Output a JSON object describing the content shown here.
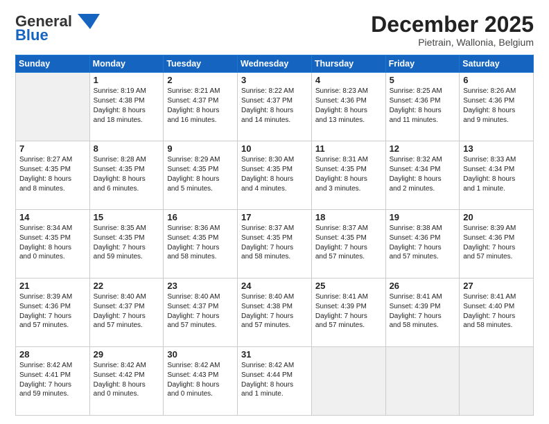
{
  "logo": {
    "general": "General",
    "blue": "Blue"
  },
  "header": {
    "month": "December 2025",
    "location": "Pietrain, Wallonia, Belgium"
  },
  "weekdays": [
    "Sunday",
    "Monday",
    "Tuesday",
    "Wednesday",
    "Thursday",
    "Friday",
    "Saturday"
  ],
  "weeks": [
    [
      {
        "day": "",
        "detail": ""
      },
      {
        "day": "1",
        "detail": "Sunrise: 8:19 AM\nSunset: 4:38 PM\nDaylight: 8 hours\nand 18 minutes."
      },
      {
        "day": "2",
        "detail": "Sunrise: 8:21 AM\nSunset: 4:37 PM\nDaylight: 8 hours\nand 16 minutes."
      },
      {
        "day": "3",
        "detail": "Sunrise: 8:22 AM\nSunset: 4:37 PM\nDaylight: 8 hours\nand 14 minutes."
      },
      {
        "day": "4",
        "detail": "Sunrise: 8:23 AM\nSunset: 4:36 PM\nDaylight: 8 hours\nand 13 minutes."
      },
      {
        "day": "5",
        "detail": "Sunrise: 8:25 AM\nSunset: 4:36 PM\nDaylight: 8 hours\nand 11 minutes."
      },
      {
        "day": "6",
        "detail": "Sunrise: 8:26 AM\nSunset: 4:36 PM\nDaylight: 8 hours\nand 9 minutes."
      }
    ],
    [
      {
        "day": "7",
        "detail": "Sunrise: 8:27 AM\nSunset: 4:35 PM\nDaylight: 8 hours\nand 8 minutes."
      },
      {
        "day": "8",
        "detail": "Sunrise: 8:28 AM\nSunset: 4:35 PM\nDaylight: 8 hours\nand 6 minutes."
      },
      {
        "day": "9",
        "detail": "Sunrise: 8:29 AM\nSunset: 4:35 PM\nDaylight: 8 hours\nand 5 minutes."
      },
      {
        "day": "10",
        "detail": "Sunrise: 8:30 AM\nSunset: 4:35 PM\nDaylight: 8 hours\nand 4 minutes."
      },
      {
        "day": "11",
        "detail": "Sunrise: 8:31 AM\nSunset: 4:35 PM\nDaylight: 8 hours\nand 3 minutes."
      },
      {
        "day": "12",
        "detail": "Sunrise: 8:32 AM\nSunset: 4:34 PM\nDaylight: 8 hours\nand 2 minutes."
      },
      {
        "day": "13",
        "detail": "Sunrise: 8:33 AM\nSunset: 4:34 PM\nDaylight: 8 hours\nand 1 minute."
      }
    ],
    [
      {
        "day": "14",
        "detail": "Sunrise: 8:34 AM\nSunset: 4:35 PM\nDaylight: 8 hours\nand 0 minutes."
      },
      {
        "day": "15",
        "detail": "Sunrise: 8:35 AM\nSunset: 4:35 PM\nDaylight: 7 hours\nand 59 minutes."
      },
      {
        "day": "16",
        "detail": "Sunrise: 8:36 AM\nSunset: 4:35 PM\nDaylight: 7 hours\nand 58 minutes."
      },
      {
        "day": "17",
        "detail": "Sunrise: 8:37 AM\nSunset: 4:35 PM\nDaylight: 7 hours\nand 58 minutes."
      },
      {
        "day": "18",
        "detail": "Sunrise: 8:37 AM\nSunset: 4:35 PM\nDaylight: 7 hours\nand 57 minutes."
      },
      {
        "day": "19",
        "detail": "Sunrise: 8:38 AM\nSunset: 4:36 PM\nDaylight: 7 hours\nand 57 minutes."
      },
      {
        "day": "20",
        "detail": "Sunrise: 8:39 AM\nSunset: 4:36 PM\nDaylight: 7 hours\nand 57 minutes."
      }
    ],
    [
      {
        "day": "21",
        "detail": "Sunrise: 8:39 AM\nSunset: 4:36 PM\nDaylight: 7 hours\nand 57 minutes."
      },
      {
        "day": "22",
        "detail": "Sunrise: 8:40 AM\nSunset: 4:37 PM\nDaylight: 7 hours\nand 57 minutes."
      },
      {
        "day": "23",
        "detail": "Sunrise: 8:40 AM\nSunset: 4:37 PM\nDaylight: 7 hours\nand 57 minutes."
      },
      {
        "day": "24",
        "detail": "Sunrise: 8:40 AM\nSunset: 4:38 PM\nDaylight: 7 hours\nand 57 minutes."
      },
      {
        "day": "25",
        "detail": "Sunrise: 8:41 AM\nSunset: 4:39 PM\nDaylight: 7 hours\nand 57 minutes."
      },
      {
        "day": "26",
        "detail": "Sunrise: 8:41 AM\nSunset: 4:39 PM\nDaylight: 7 hours\nand 58 minutes."
      },
      {
        "day": "27",
        "detail": "Sunrise: 8:41 AM\nSunset: 4:40 PM\nDaylight: 7 hours\nand 58 minutes."
      }
    ],
    [
      {
        "day": "28",
        "detail": "Sunrise: 8:42 AM\nSunset: 4:41 PM\nDaylight: 7 hours\nand 59 minutes."
      },
      {
        "day": "29",
        "detail": "Sunrise: 8:42 AM\nSunset: 4:42 PM\nDaylight: 8 hours\nand 0 minutes."
      },
      {
        "day": "30",
        "detail": "Sunrise: 8:42 AM\nSunset: 4:43 PM\nDaylight: 8 hours\nand 0 minutes."
      },
      {
        "day": "31",
        "detail": "Sunrise: 8:42 AM\nSunset: 4:44 PM\nDaylight: 8 hours\nand 1 minute."
      },
      {
        "day": "",
        "detail": ""
      },
      {
        "day": "",
        "detail": ""
      },
      {
        "day": "",
        "detail": ""
      }
    ]
  ]
}
